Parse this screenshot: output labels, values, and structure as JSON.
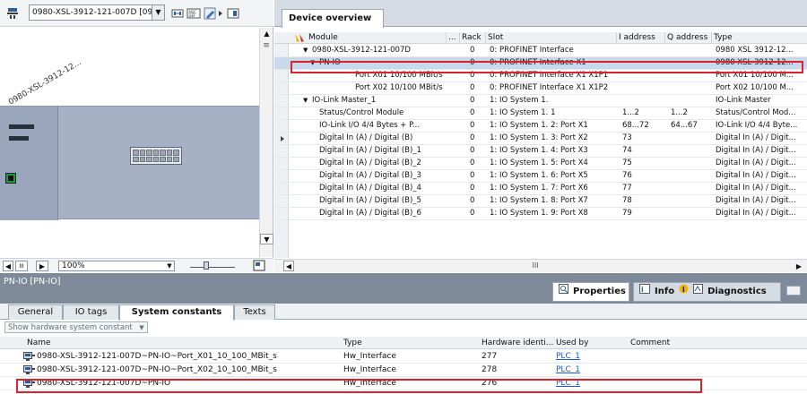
{
  "left_toolbar": {
    "device_selector_value": "0980-XSL-3912-121-007D [09",
    "icons": [
      "device-icon",
      "dropdown-icon",
      "network-view-icon",
      "show-module-labels-icon",
      "zoom-tool-icon",
      "expand-icon"
    ]
  },
  "canvas": {
    "device_label": "0980-XSL-3912-12..."
  },
  "left_bottom": {
    "zoom_value": "100%",
    "zoom_level": 0.33
  },
  "device_overview": {
    "tab_label": "Device overview",
    "columns": [
      "Module",
      "...",
      "Rack",
      "Slot",
      "I address",
      "Q address",
      "Type"
    ],
    "rows": [
      {
        "module": "0980-XSL-3912-121-007D",
        "rack": "0",
        "slot": "0: PROFINET Interface",
        "i": "",
        "q": "",
        "type": "0980 XSL 3912-12...",
        "indent": 1,
        "expander": "▼",
        "selected": false,
        "marker": false
      },
      {
        "module": "PN-IO",
        "rack": "0",
        "slot": "0: PROFINET Interface X1",
        "i": "",
        "q": "",
        "type": "0980-XSL-3912-12...",
        "indent": 2,
        "expander": "▼",
        "selected": true,
        "marker": false
      },
      {
        "module": "Port X01 10/100 MBit/s",
        "rack": "0",
        "slot": "0: PROFINET Interface X1 X1P1",
        "i": "",
        "q": "",
        "type": "Port X01 10/100 M...",
        "indent": 3,
        "expander": "",
        "selected": false,
        "marker": false
      },
      {
        "module": "Port X02 10/100 MBit/s",
        "rack": "0",
        "slot": "0: PROFINET Interface X1 X1P2",
        "i": "",
        "q": "",
        "type": "Port X02 10/100 M...",
        "indent": 3,
        "expander": "",
        "selected": false,
        "marker": false
      },
      {
        "module": "IO-Link Master_1",
        "rack": "0",
        "slot": "1: IO System 1.",
        "i": "",
        "q": "",
        "type": "IO-Link Master",
        "indent": 1,
        "expander": "▼",
        "selected": false,
        "marker": false
      },
      {
        "module": "Status/Control Module",
        "rack": "0",
        "slot": "1: IO System 1. 1",
        "i": "1...2",
        "q": "1...2",
        "type": "Status/Control Mod...",
        "indent": 2,
        "expander": "",
        "selected": false,
        "marker": false
      },
      {
        "module": "IO-Link I/O 4/4 Bytes + P...",
        "rack": "0",
        "slot": "1: IO System 1. 2: Port X1",
        "i": "68...72",
        "q": "64...67",
        "type": "IO-Link I/O 4/4 Byte...",
        "indent": 2,
        "expander": "",
        "selected": false,
        "marker": false
      },
      {
        "module": "Digital In (A) / Digital (B)",
        "rack": "0",
        "slot": "1: IO System 1. 3: Port X2",
        "i": "73",
        "q": "",
        "type": "Digital In (A) / Digit...",
        "indent": 2,
        "expander": "",
        "selected": false,
        "marker": true
      },
      {
        "module": "Digital In (A) / Digital (B)_1",
        "rack": "0",
        "slot": "1: IO System 1. 4: Port X3",
        "i": "74",
        "q": "",
        "type": "Digital In (A) / Digit...",
        "indent": 2,
        "expander": "",
        "selected": false,
        "marker": false
      },
      {
        "module": "Digital In (A) / Digital (B)_2",
        "rack": "0",
        "slot": "1: IO System 1. 5: Port X4",
        "i": "75",
        "q": "",
        "type": "Digital In (A) / Digit...",
        "indent": 2,
        "expander": "",
        "selected": false,
        "marker": false
      },
      {
        "module": "Digital In (A) / Digital (B)_3",
        "rack": "0",
        "slot": "1: IO System 1. 6: Port X5",
        "i": "76",
        "q": "",
        "type": "Digital In (A) / Digit...",
        "indent": 2,
        "expander": "",
        "selected": false,
        "marker": false
      },
      {
        "module": "Digital In (A) / Digital (B)_4",
        "rack": "0",
        "slot": "1: IO System 1. 7: Port X6",
        "i": "77",
        "q": "",
        "type": "Digital In (A) / Digit...",
        "indent": 2,
        "expander": "",
        "selected": false,
        "marker": false
      },
      {
        "module": "Digital In (A) / Digital (B)_5",
        "rack": "0",
        "slot": "1: IO System 1. 8: Port X7",
        "i": "78",
        "q": "",
        "type": "Digital In (A) / Digit...",
        "indent": 2,
        "expander": "",
        "selected": false,
        "marker": false
      },
      {
        "module": "Digital In (A) / Digital (B)_6",
        "rack": "0",
        "slot": "1: IO System 1. 9: Port X8",
        "i": "79",
        "q": "",
        "type": "Digital In (A) / Digit...",
        "indent": 2,
        "expander": "",
        "selected": false,
        "marker": false
      }
    ],
    "hscroll_grip": "III"
  },
  "inspector": {
    "title": "PN-IO [PN-IO]",
    "properties_tab": "Properties",
    "info_tab": "Info",
    "diagnostics_tab": "Diagnostics",
    "sub_tabs": [
      "General",
      "IO tags",
      "System constants",
      "Texts"
    ],
    "active_sub_tab": "System constants",
    "filter_placeholder": "Show hardware system constant",
    "columns": [
      "Name",
      "Type",
      "Hardware identi...",
      "Used by",
      "Comment"
    ],
    "rows": [
      {
        "name": "0980-XSL-3912-121-007D~PN-IO~Port_X01_10_100_MBit_s",
        "type": "Hw_Interface",
        "hwid": "277",
        "used_by": "PLC_1",
        "comment": ""
      },
      {
        "name": "0980-XSL-3912-121-007D~PN-IO~Port_X02_10_100_MBit_s",
        "type": "Hw_Interface",
        "hwid": "278",
        "used_by": "PLC_1",
        "comment": ""
      },
      {
        "name": "0980-XSL-3912-121-007D~PN-IO",
        "type": "Hw_Interface",
        "hwid": "276",
        "used_by": "PLC_1",
        "comment": ""
      }
    ]
  },
  "colors": {
    "highlight_border": "#d9242f",
    "selected_row": "#c9d8ea",
    "inspector_header": "#7e8a99",
    "link": "#1a5ad6"
  }
}
